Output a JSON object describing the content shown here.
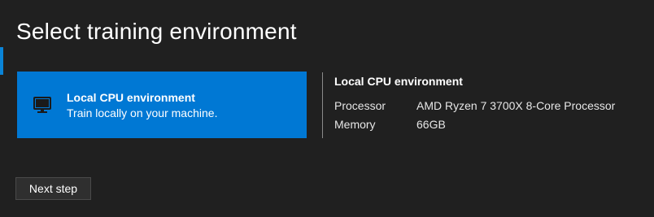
{
  "page": {
    "title": "Select training environment"
  },
  "environment_card": {
    "icon": "monitor-icon",
    "title": "Local CPU environment",
    "description": "Train locally on your machine.",
    "selected": true
  },
  "details": {
    "title": "Local CPU environment",
    "rows": [
      {
        "label": "Processor",
        "value": "AMD Ryzen 7 3700X 8-Core Processor"
      },
      {
        "label": "Memory",
        "value": "66GB"
      }
    ]
  },
  "actions": {
    "next_label": "Next step"
  },
  "colors": {
    "background": "#202020",
    "accent": "#0078d4",
    "accent_bar": "#0a84d8",
    "divider": "#8a8a8a",
    "button_bg": "#2f2f2f"
  }
}
